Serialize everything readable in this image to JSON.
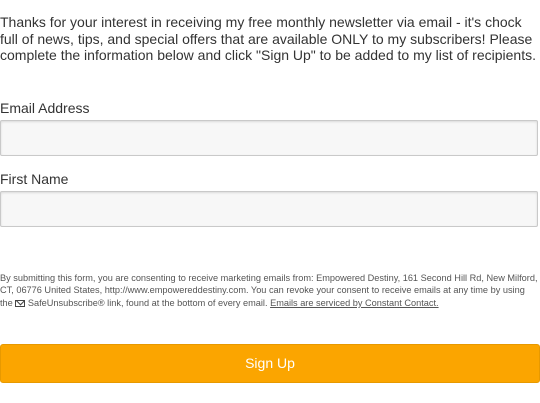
{
  "intro": {
    "text": "Thanks for your interest in receiving my free monthly newsletter via email - it's chock full of news, tips, and special offers that are available ONLY to my subscribers! Please complete the information below and click \"Sign Up\" to be added to my list of recipients."
  },
  "form": {
    "email_label": "Email Address",
    "email_value": "",
    "first_name_label": "First Name",
    "first_name_value": ""
  },
  "consent": {
    "text_before_icon": "By submitting this form, you are consenting to receive marketing emails from: Empowered Destiny, 161 Second Hill Rd, New Milford, CT, 06776 United States, http://www.empowereddestiny.com. You can revoke your consent to receive emails at any time by using the ",
    "text_after_icon": " SafeUnsubscribe® link, found at the bottom of every email. ",
    "link_text": "Emails are serviced by Constant Contact.",
    "icon": "envelope-icon"
  },
  "button": {
    "label": "Sign Up",
    "color": "#fba500"
  }
}
